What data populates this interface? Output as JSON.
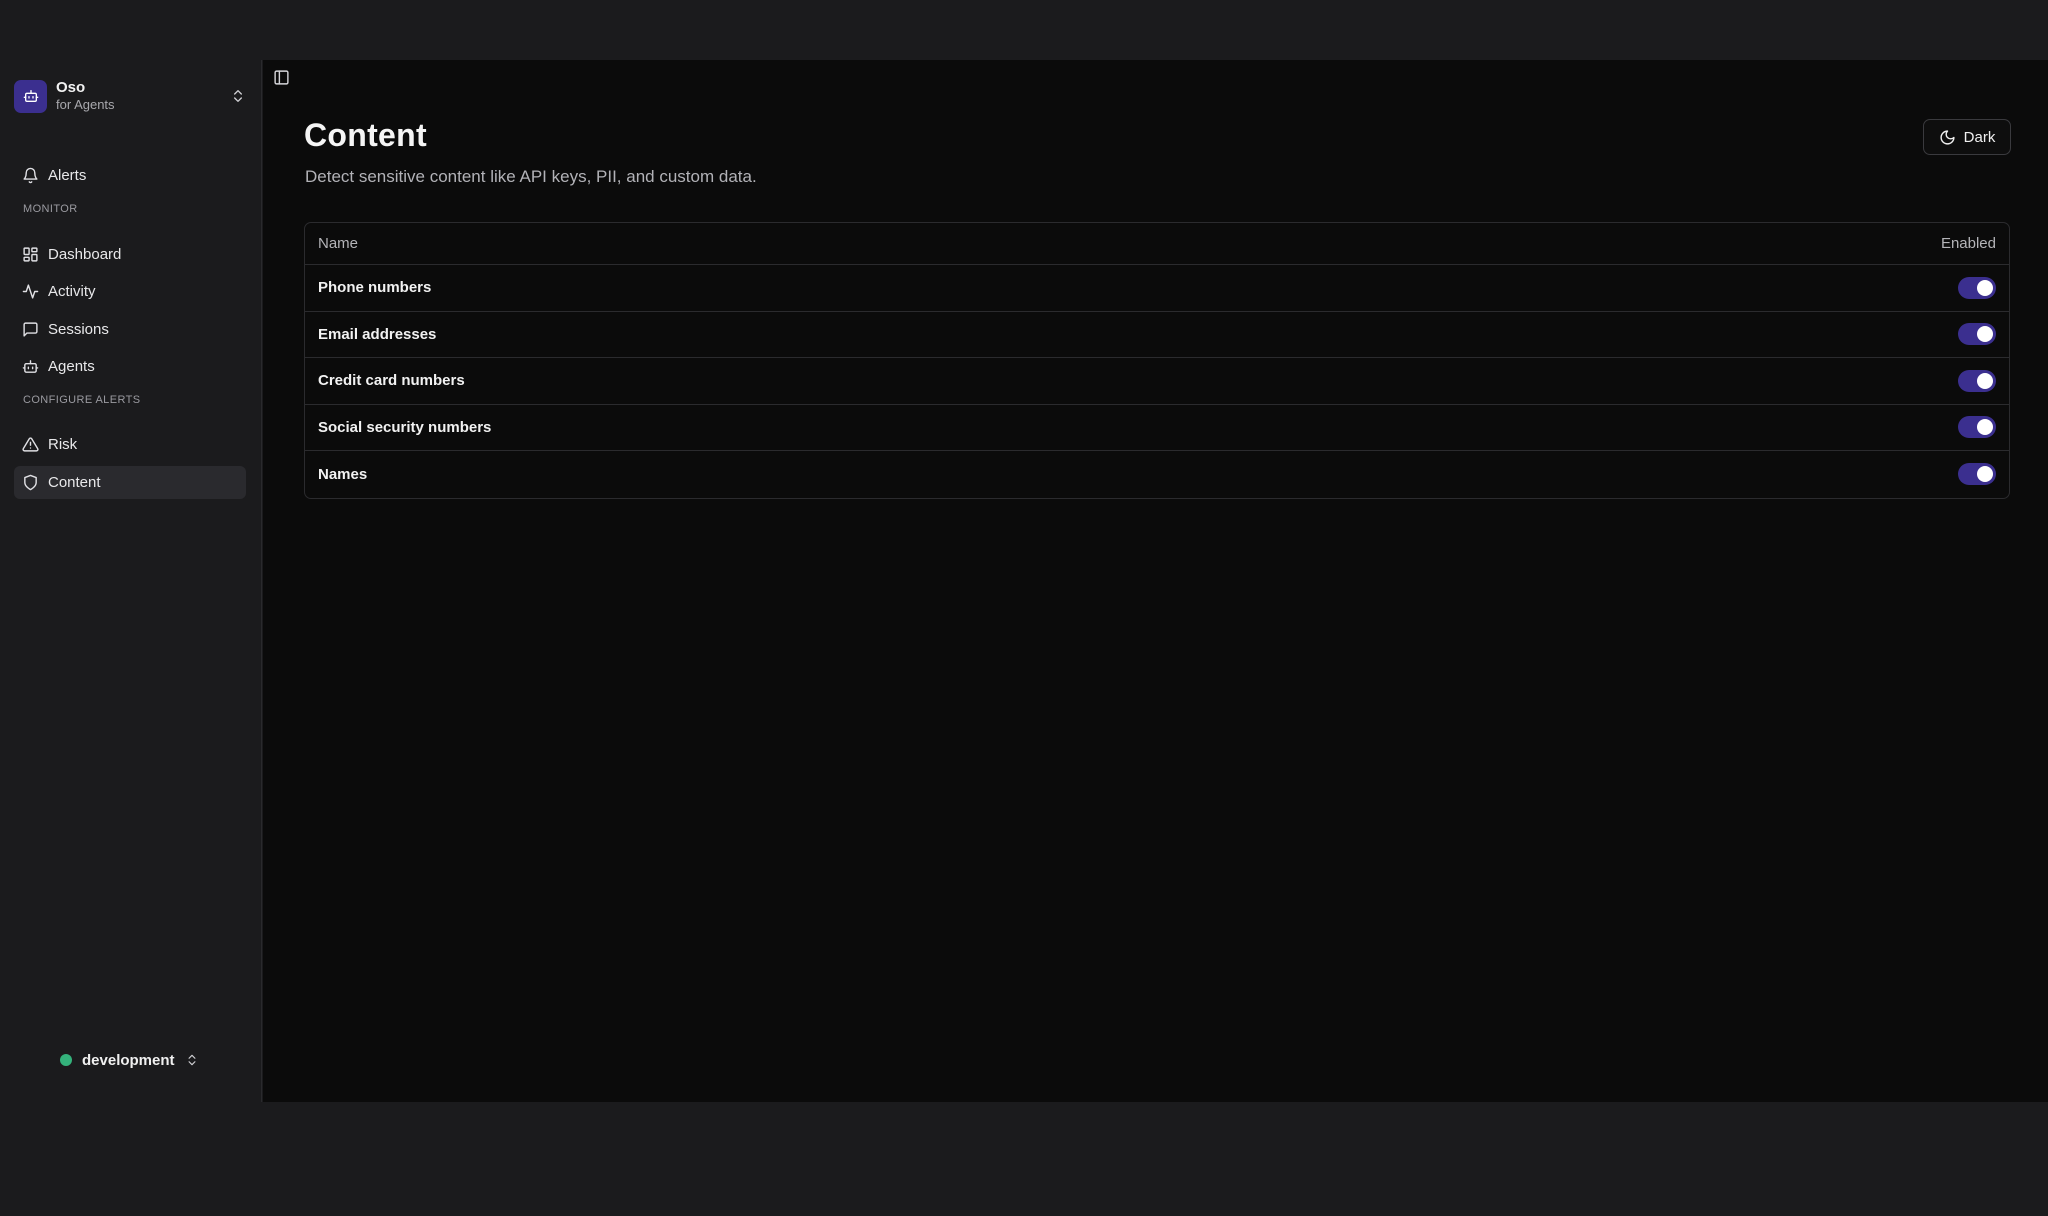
{
  "org": {
    "name": "Oso",
    "subtitle": "for Agents"
  },
  "sidebar": {
    "top_items": [
      {
        "label": "Alerts",
        "icon": "bell-icon"
      }
    ],
    "sections": [
      {
        "title": "Monitor",
        "items": [
          {
            "label": "Dashboard",
            "icon": "dashboard-icon"
          },
          {
            "label": "Activity",
            "icon": "activity-icon"
          },
          {
            "label": "Sessions",
            "icon": "message-icon"
          },
          {
            "label": "Agents",
            "icon": "bot-icon"
          }
        ]
      },
      {
        "title": "Configure Alerts",
        "items": [
          {
            "label": "Risk",
            "icon": "warning-icon"
          },
          {
            "label": "Content",
            "icon": "shield-icon",
            "active": true
          }
        ]
      }
    ]
  },
  "environment": {
    "label": "development",
    "status_color": "#34b27b"
  },
  "page": {
    "title": "Content",
    "subtitle": "Detect sensitive content like API keys, PII, and custom data."
  },
  "theme_toggle": {
    "label": "Dark",
    "icon": "moon-icon"
  },
  "table": {
    "columns": [
      "Name",
      "Enabled"
    ],
    "rows": [
      {
        "name": "Phone numbers",
        "enabled": true
      },
      {
        "name": "Email addresses",
        "enabled": true
      },
      {
        "name": "Credit card numbers",
        "enabled": true
      },
      {
        "name": "Social security numbers",
        "enabled": true
      },
      {
        "name": "Names",
        "enabled": true
      }
    ]
  },
  "colors": {
    "accent": "#3b2f8f",
    "background": "#0b0b0b",
    "sidebar": "#1b1b1d"
  }
}
